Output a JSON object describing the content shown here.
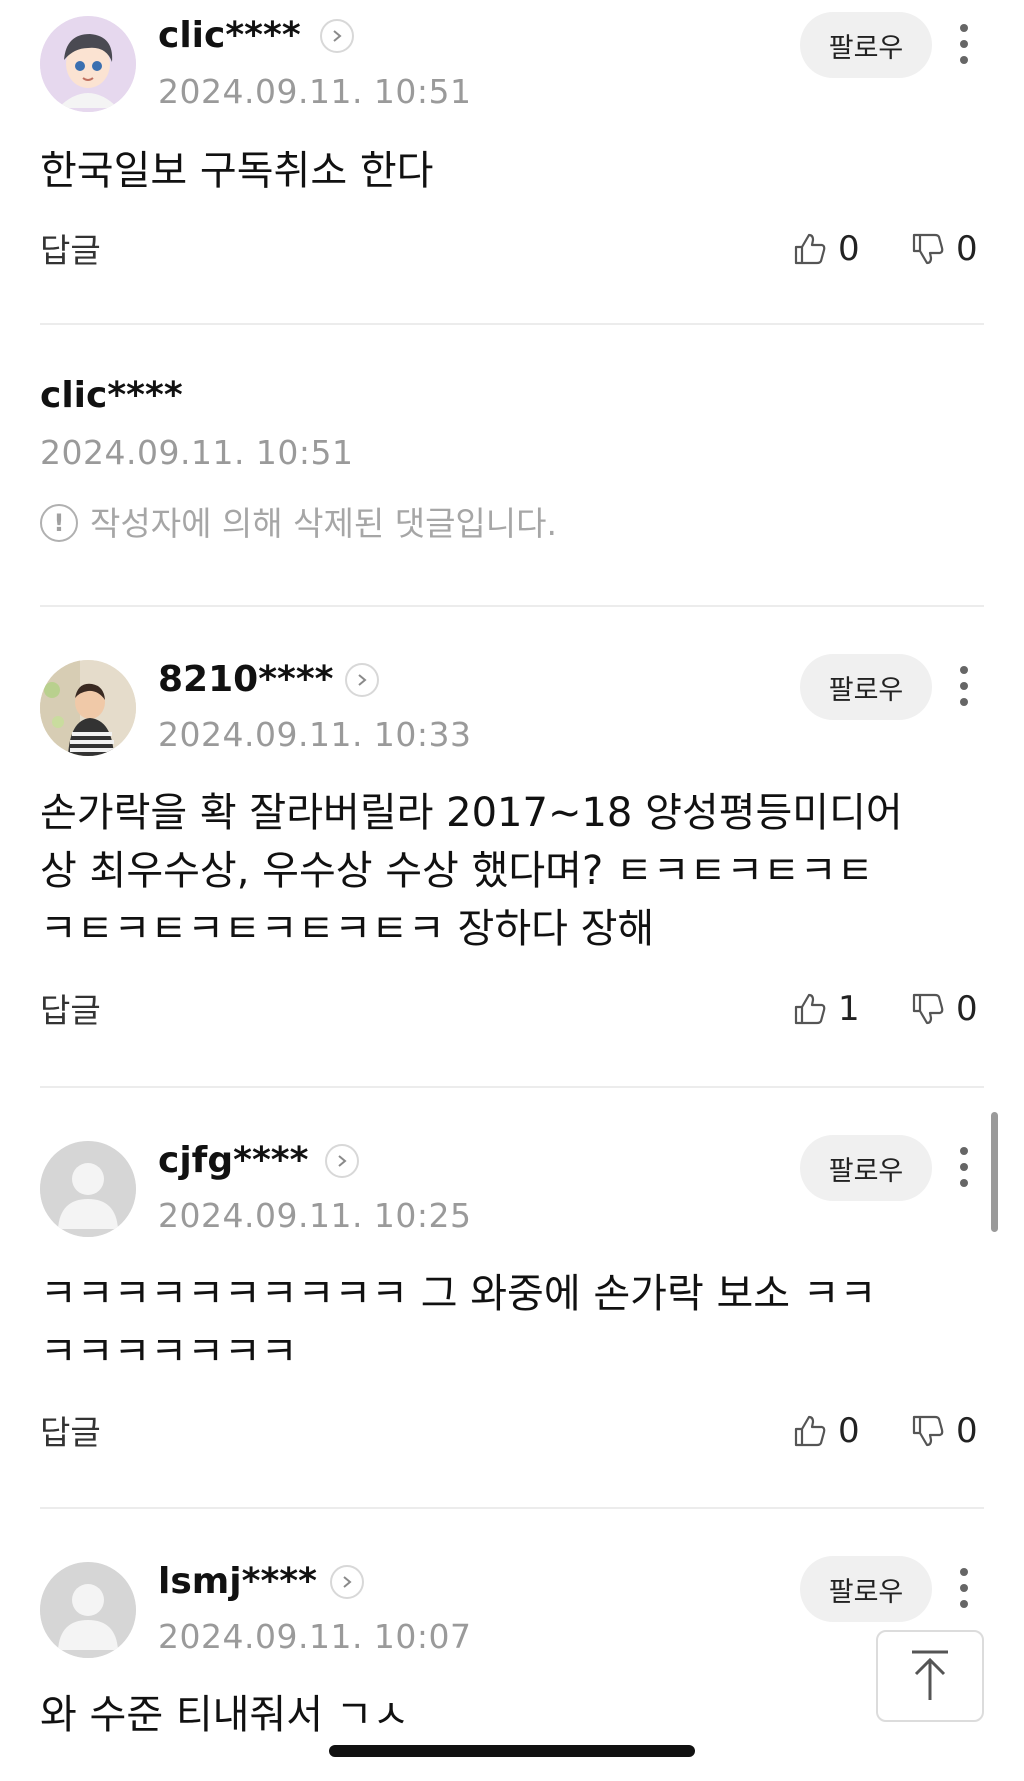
{
  "comments": [
    {
      "username": "clic****",
      "timestamp": "2024.09.11. 10:51",
      "body": "한국일보 구독취소 한다",
      "follow_label": "팔로우",
      "reply_label": "답글",
      "likes": "0",
      "dislikes": "0",
      "avatar": "cartoon-boy-avatar"
    },
    {
      "username": "clic****",
      "timestamp": "2024.09.11. 10:51",
      "deleted_text": "작성자에 의해 삭제된 댓글입니다."
    },
    {
      "username": "8210****",
      "timestamp": "2024.09.11. 10:33",
      "body": "손가락을 확 잘라버릴라 2017~18 양성평등미디어\n상 최우수상, 우수상 수상 했다며? ㅌㅋㅌㅋㅌㅋㅌ\nㅋㅌㅋㅌㅋㅌㅋㅌㅋㅌㅋ 장하다 장해",
      "follow_label": "팔로우",
      "reply_label": "답글",
      "likes": "1",
      "dislikes": "0",
      "avatar": "child-photo-avatar"
    },
    {
      "username": "cjfg****",
      "timestamp": "2024.09.11. 10:25",
      "body": "ㅋㅋㅋㅋㅋㅋㅋㅋㅋㅋ 그 와중에 손가락 보소 ㅋㅋ\nㅋㅋㅋㅋㅋㅋㅋ",
      "follow_label": "팔로우",
      "reply_label": "답글",
      "likes": "0",
      "dislikes": "0",
      "avatar": "default-person-avatar"
    },
    {
      "username": "lsmj****",
      "timestamp": "2024.09.11. 10:07",
      "body": "와 수준 티내줘서 ㄱㅅ",
      "follow_label": "팔로우",
      "avatar": "default-person-avatar"
    }
  ],
  "icons": {
    "like": "thumbs-up-icon",
    "dislike": "thumbs-down-icon",
    "more": "more-vertical-icon",
    "profile_link": "chevron-right-icon",
    "deleted": "exclamation-circle-icon",
    "scroll_top": "arrow-up-icon"
  }
}
